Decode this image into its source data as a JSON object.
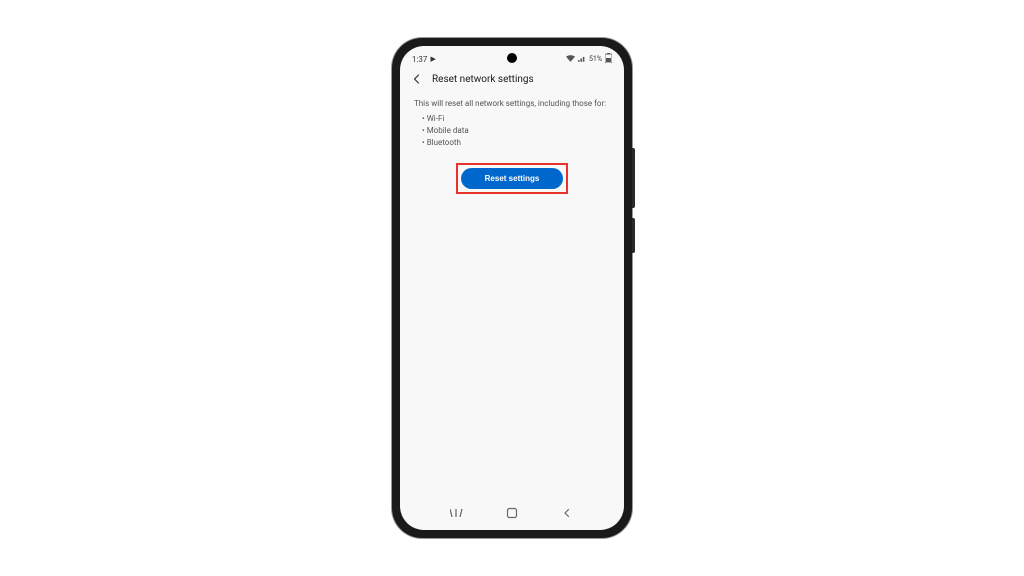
{
  "status_bar": {
    "time": "1:37",
    "battery_text": "51%"
  },
  "header": {
    "title": "Reset network settings"
  },
  "content": {
    "description": "This will reset all network settings, including those for:",
    "bullets": [
      "Wi-Fi",
      "Mobile data",
      "Bluetooth"
    ]
  },
  "button": {
    "label": "Reset settings"
  },
  "colors": {
    "highlight_border": "#e8322c",
    "button_bg": "#0068cc"
  }
}
